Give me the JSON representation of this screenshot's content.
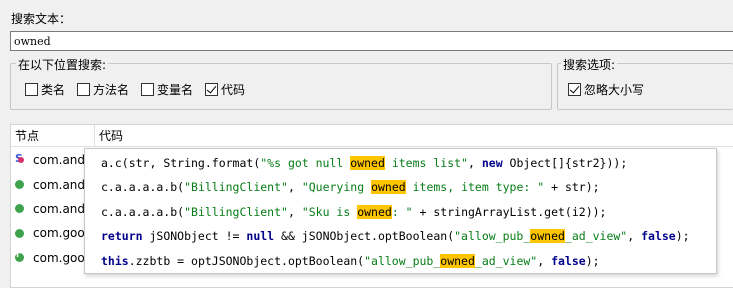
{
  "search": {
    "label": "搜索文本：",
    "value": "owned"
  },
  "location_group": {
    "title": "在以下位置搜索:",
    "options": [
      {
        "label": "类名",
        "checked": false
      },
      {
        "label": "方法名",
        "checked": false
      },
      {
        "label": "变量名",
        "checked": false
      },
      {
        "label": "代码",
        "checked": true
      }
    ]
  },
  "options_group": {
    "title": "搜索选项:",
    "options": [
      {
        "label": "忽略大小写",
        "checked": true
      }
    ]
  },
  "results": {
    "columns": {
      "node": "节点",
      "code": "代码"
    },
    "rows": [
      {
        "node": "com.andro",
        "icon": "static-method-icon"
      },
      {
        "node": "com.andro",
        "icon": "method-icon"
      },
      {
        "node": "com.andro",
        "icon": "method-icon"
      },
      {
        "node": "com.googl",
        "icon": "method-icon"
      },
      {
        "node": "com.googl",
        "icon": "final-method-icon"
      }
    ],
    "code_lines": [
      [
        {
          "t": "a.c(str, "
        },
        {
          "t": "String.format(",
          "c": "plain"
        },
        {
          "t": "\"%s got null ",
          "c": "str"
        },
        {
          "t": "owned",
          "c": "str hl"
        },
        {
          "t": " items list\"",
          "c": "str"
        },
        {
          "t": ", "
        },
        {
          "t": "new",
          "c": "kw"
        },
        {
          "t": " Object[]{str2}));"
        }
      ],
      [
        {
          "t": "c.a.a.a.a.b("
        },
        {
          "t": "\"BillingClient\"",
          "c": "str"
        },
        {
          "t": ", "
        },
        {
          "t": "\"Querying ",
          "c": "str"
        },
        {
          "t": "owned",
          "c": "str hl"
        },
        {
          "t": " items, item type: \"",
          "c": "str"
        },
        {
          "t": " + str);"
        }
      ],
      [
        {
          "t": "c.a.a.a.a.b("
        },
        {
          "t": "\"BillingClient\"",
          "c": "str"
        },
        {
          "t": ", "
        },
        {
          "t": "\"Sku is ",
          "c": "str"
        },
        {
          "t": "owned",
          "c": "str hl"
        },
        {
          "t": ": \"",
          "c": "str"
        },
        {
          "t": " + stringArrayList.get(i2));"
        }
      ],
      [
        {
          "t": "return",
          "c": "kw"
        },
        {
          "t": " jSONObject != "
        },
        {
          "t": "null",
          "c": "kw"
        },
        {
          "t": " && jSONObject.optBoolean("
        },
        {
          "t": "\"allow_pub_",
          "c": "str"
        },
        {
          "t": "owned",
          "c": "str hl"
        },
        {
          "t": "_ad_view\"",
          "c": "str"
        },
        {
          "t": ", "
        },
        {
          "t": "false",
          "c": "kw"
        },
        {
          "t": ");"
        }
      ],
      [
        {
          "t": "this",
          "c": "kw"
        },
        {
          "t": ".zzbtb = optJSONObject.optBoolean("
        },
        {
          "t": "\"allow_pub_",
          "c": "str"
        },
        {
          "t": "owned",
          "c": "str hl"
        },
        {
          "t": "_ad_view\"",
          "c": "str"
        },
        {
          "t": ", "
        },
        {
          "t": "false",
          "c": "kw"
        },
        {
          "t": ");"
        }
      ]
    ]
  },
  "colors": {
    "highlight": "#ffc600",
    "keyword": "#00008b",
    "string": "#067d17",
    "method_icon": "#3fa34d"
  }
}
